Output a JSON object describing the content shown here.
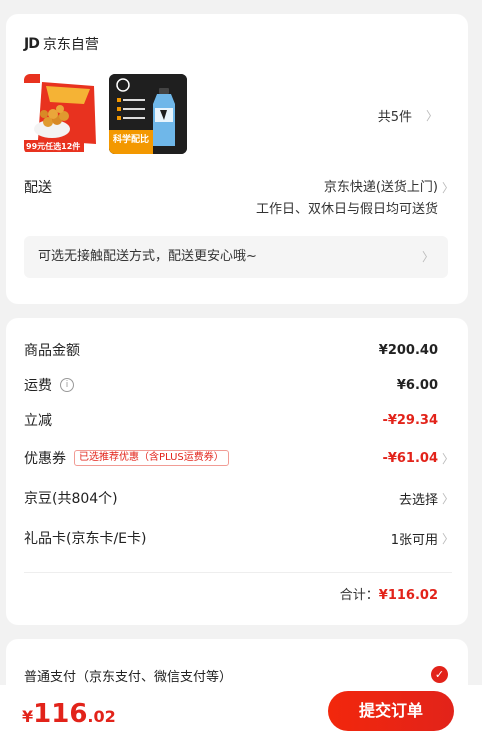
{
  "store": {
    "logo_text": "JD",
    "name": "京东自营",
    "item_count_label": "共5件",
    "products": [
      {
        "name": "snack-food-product",
        "badge_top": "",
        "badge_bottom": "99元任选12件"
      },
      {
        "name": "sports-drink-product",
        "badge": "科学配比"
      }
    ]
  },
  "delivery": {
    "label": "配送",
    "method": "京东快递(送货上门)",
    "schedule": "工作日、双休日与假日均可送货",
    "notice": "可选无接触配送方式，配送更安心哦~"
  },
  "pricing": {
    "rows": [
      {
        "label": "商品金额",
        "value": "¥200.40"
      },
      {
        "label": "运费",
        "value": "¥6.00"
      },
      {
        "label": "立减",
        "value": "-¥29.34"
      },
      {
        "label": "优惠券",
        "tag": "已选推荐优惠（含PLUS运费券）",
        "value": "-¥61.04"
      },
      {
        "label": "京豆(共804个)",
        "value": "去选择"
      },
      {
        "label": "礼品卡(京东卡/E卡)",
        "value": "1张可用"
      }
    ],
    "total_label": "合计：",
    "total_value": "¥116.02"
  },
  "payment": {
    "method_label": "普通支付（京东支付、微信支付等）"
  },
  "footer": {
    "currency": "¥",
    "price_int": "116",
    "price_dec": ".02",
    "submit_label": "提交订单"
  },
  "colors": {
    "accent": "#e2231a",
    "background": "#f2f2f2"
  }
}
